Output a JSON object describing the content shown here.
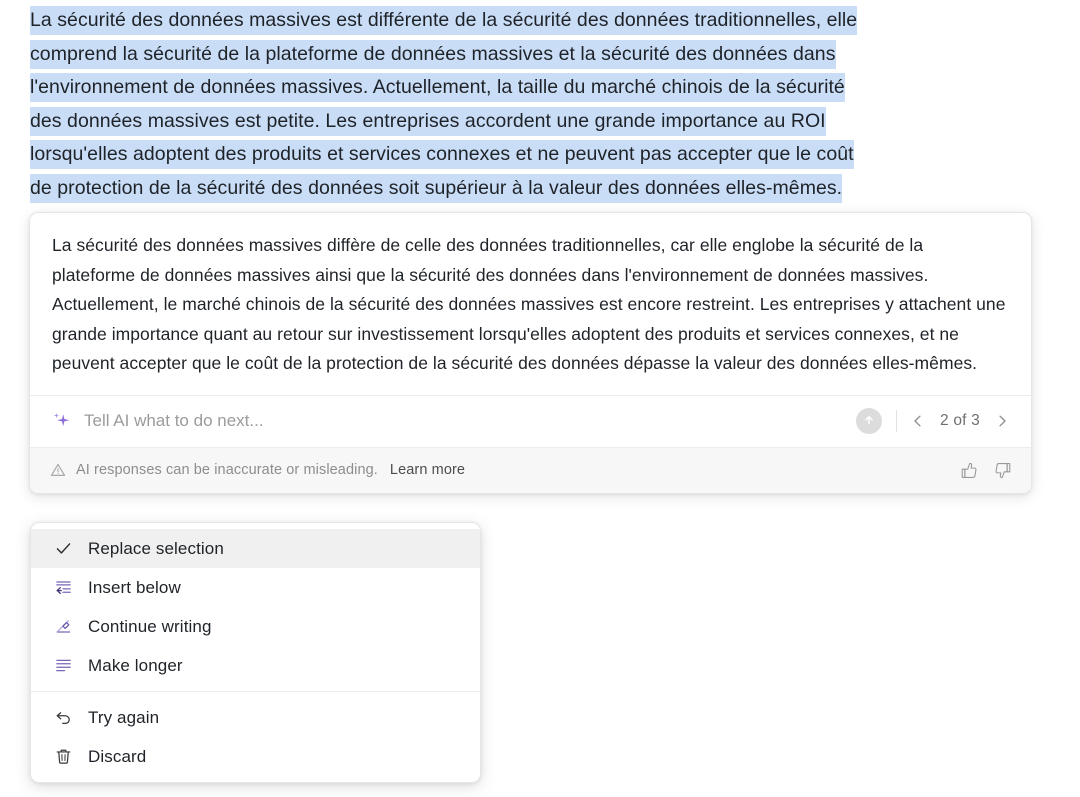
{
  "document": {
    "selection_color": "#c9ddf7",
    "selected_lines": [
      "La sécurité des données massives est différente de la sécurité des données traditionnelles, elle",
      "comprend la sécurité de la plateforme de données massives et la sécurité des données dans",
      "l'environnement de données massives. Actuellement, la taille du marché chinois de la sécurité",
      "des données massives est petite. Les entreprises accordent une grande importance au ROI",
      "lorsqu'elles adoptent des produits et services connexes et ne peuvent pas accepter que le coût",
      "de protection de la sécurité des données soit supérieur à la valeur des données elles-mêmes."
    ]
  },
  "ai_card": {
    "response_text": "La sécurité des données massives diffère de celle des données traditionnelles, car elle englobe la sécurité de la plateforme de données massives ainsi que la sécurité des données dans l'environnement de données massives. Actuellement, le marché chinois de la sécurité des données massives est encore restreint. Les entreprises y attachent une grande importance quant au retour sur investissement lorsqu'elles adoptent des produits et services connexes, et ne peuvent accepter que le coût de la protection de la sécurité des données dépasse la valeur des données elles-mêmes.",
    "prompt": {
      "icon": "sparkle-icon",
      "icon_color": "#8b6fd6",
      "value": "",
      "placeholder": "Tell AI what to do next..."
    },
    "submit": {
      "icon": "arrow-up-icon",
      "label": "Submit"
    },
    "pager": {
      "prev_icon": "chevron-left-icon",
      "next_icon": "chevron-right-icon",
      "count_label": "2 of 3",
      "current": 2,
      "total": 3
    },
    "disclaimer": {
      "icon": "warning-triangle-icon",
      "text": "AI responses can be inaccurate or misleading.",
      "link_label": "Learn more"
    },
    "feedback": {
      "up_icon": "thumbs-up-icon",
      "down_icon": "thumbs-down-icon"
    }
  },
  "menu": {
    "items": [
      {
        "label": "Replace selection",
        "icon": "checkmark-icon",
        "selected": true
      },
      {
        "label": "Insert below",
        "icon": "insert-below-icon",
        "selected": false
      },
      {
        "label": "Continue writing",
        "icon": "pencil-line-icon",
        "selected": false
      },
      {
        "label": "Make longer",
        "icon": "make-longer-icon",
        "selected": false
      }
    ],
    "footer_items": [
      {
        "label": "Try again",
        "icon": "undo-arrow-icon"
      },
      {
        "label": "Discard",
        "icon": "trash-icon"
      }
    ]
  }
}
